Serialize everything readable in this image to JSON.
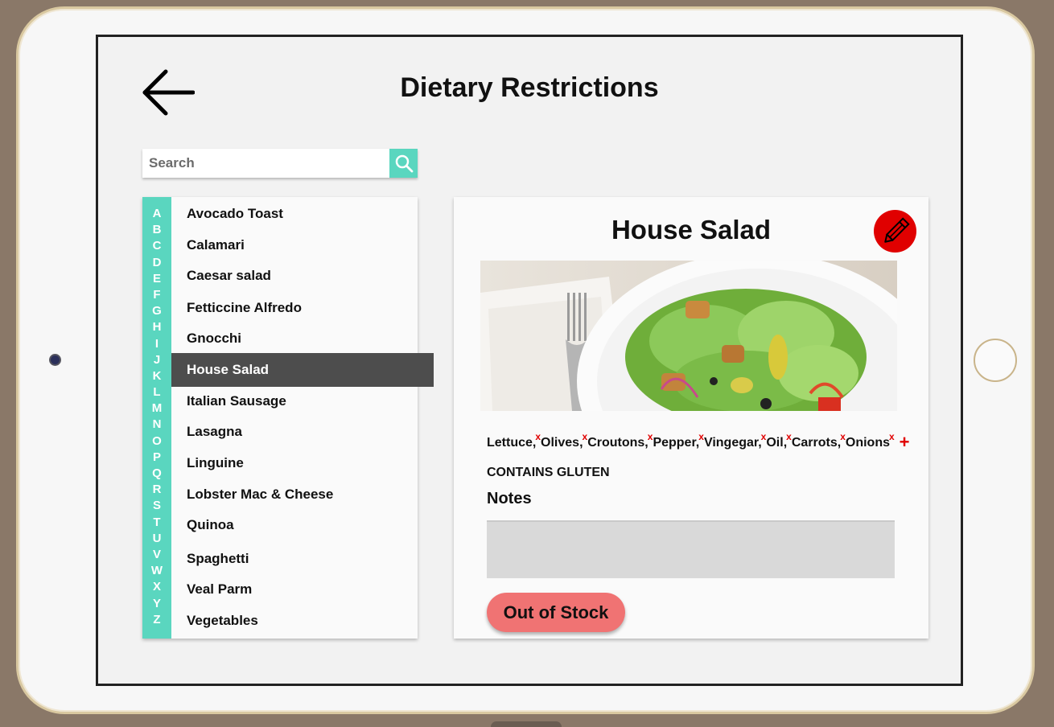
{
  "header": {
    "title": "Dietary Restrictions",
    "back_icon": "arrow-left-icon"
  },
  "search": {
    "placeholder": "Search",
    "value": "",
    "icon": "search-icon",
    "accent": "#5ad6bf"
  },
  "alphabet": [
    "A",
    "B",
    "C",
    "D",
    "E",
    "F",
    "G",
    "H",
    "I",
    "J",
    "K",
    "L",
    "M",
    "N",
    "O",
    "P",
    "Q",
    "R",
    "S",
    "T",
    "U",
    "V",
    "W",
    "X",
    "Y",
    "Z"
  ],
  "menu": {
    "selected": "House Salad",
    "items": [
      "Avocado Toast",
      "Calamari",
      "Caesar salad",
      "Fetticcine Alfredo",
      "Gnocchi",
      "House Salad",
      "Italian Sausage",
      "Lasagna",
      "Linguine",
      "Lobster Mac & Cheese",
      "Quinoa",
      "Spaghetti",
      "Veal Parm",
      "Vegetables"
    ]
  },
  "detail": {
    "title": "House Salad",
    "edit_icon": "pencil-icon",
    "image_alt": "salad-photo",
    "ingredients": [
      "Lettuce",
      "Olives",
      "Croutons",
      "Pepper",
      "Vingegar",
      "Oil",
      "Carrots",
      "Onions"
    ],
    "remove_mark": "x",
    "add_mark": "+",
    "warning": "CONTAINS GLUTEN",
    "notes_label": "Notes",
    "notes_value": "",
    "stock_button": "Out of Stock",
    "stock_color": "#f07373",
    "edit_color": "#e00000"
  }
}
